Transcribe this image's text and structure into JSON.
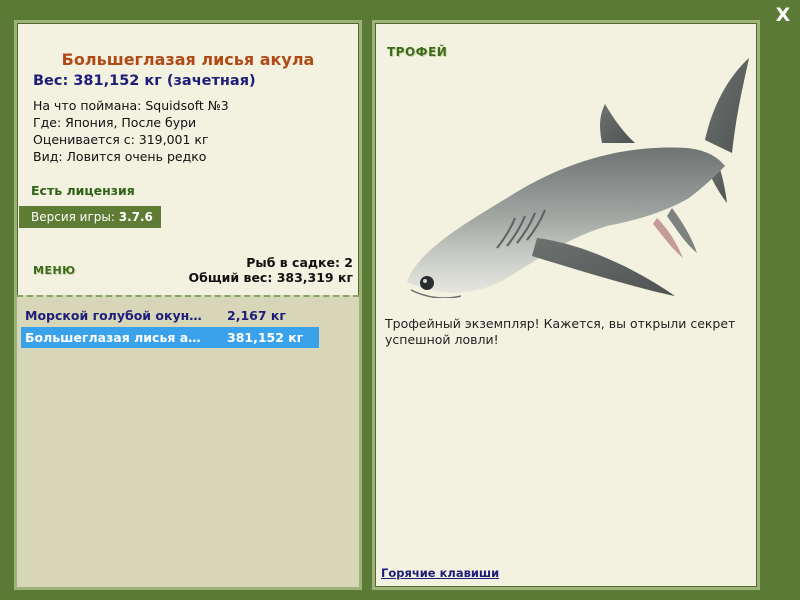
{
  "close_label": "X",
  "fish": {
    "title": "Большеглазая лисья акула",
    "weight_line": "Вес: 381,152 кг (зачетная)",
    "caught_on": "На что поймана: Squidsoft №3",
    "where": "Где: Япония, После бури",
    "valued_from": "Оценивается с: 319,001 кг",
    "rarity": "Вид: Ловится очень редко"
  },
  "license": "Есть лицензия",
  "version": {
    "label": "Версия игры:",
    "value": "3.7.6"
  },
  "menu_label": "МЕНЮ",
  "cage": {
    "count_line": "Рыб в садке: 2",
    "total_line": "Общий вес: 383,319 кг"
  },
  "catch_list": [
    {
      "name": "Морской голубой окун…",
      "weight": "2,167 кг"
    },
    {
      "name": "Большеглазая лисья а…",
      "weight": "381,152 кг"
    }
  ],
  "trophy": {
    "heading": "ТРОФЕЙ",
    "description": "Трофейный экземпляр! Кажется, вы открыли секрет успешной ловли!"
  },
  "hotkeys_label": "Горячие клавиши",
  "colors": {
    "background": "#5b7a36",
    "panel": "#f3f1df",
    "title": "#b04a17",
    "accent_blue": "#1e1e7a",
    "selected_row": "#3aa2ea"
  }
}
